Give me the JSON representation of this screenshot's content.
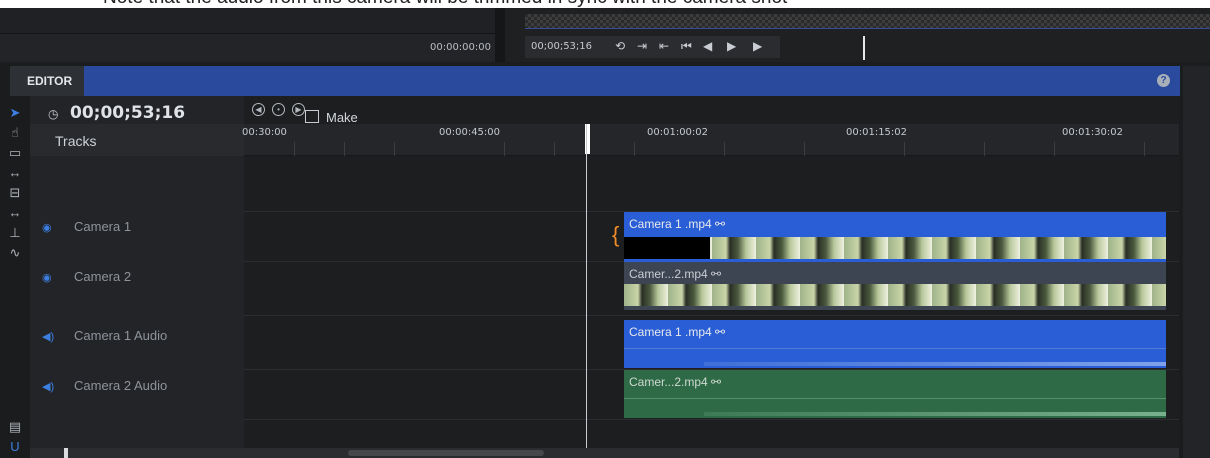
{
  "caption": "Note that the audio from this camera will be trimmed in sync with the camera shot",
  "top": {
    "source_timecode": "00:00:00:00",
    "program_timecode": "00;00;53;16"
  },
  "editor": {
    "tab_label": "EDITOR",
    "help": "?",
    "timecode": "00;00;53;16",
    "composite_label": "Make Composite Shot",
    "tracks_header": "Tracks"
  },
  "ruler": {
    "ticks": [
      "00:30:00",
      "00:00:45:00",
      "00:01:00:02",
      "00:01:15:02",
      "00:01:30:02"
    ]
  },
  "tracks": [
    {
      "name": "Camera 1",
      "icon": "eye-icon"
    },
    {
      "name": "Camera 2",
      "icon": "eye-icon"
    },
    {
      "name": "Camera 1 Audio",
      "icon": "speaker-icon"
    },
    {
      "name": "Camera 2 Audio",
      "icon": "speaker-icon"
    }
  ],
  "clips": {
    "camera1": "Camera 1 .mp4 ⚯",
    "camera2": "Camer...2.mp4 ⚯",
    "camera1_audio": "Camera 1 .mp4 ⚯",
    "camera2_audio": "Camer...2.mp4 ⚯"
  },
  "colors": {
    "accent": "#2a5ed6",
    "editor_header": "#2a4a9e",
    "audio_green": "#2e6a46",
    "video2_gray": "#3d4552",
    "trim_bracket": "#f28c28"
  }
}
